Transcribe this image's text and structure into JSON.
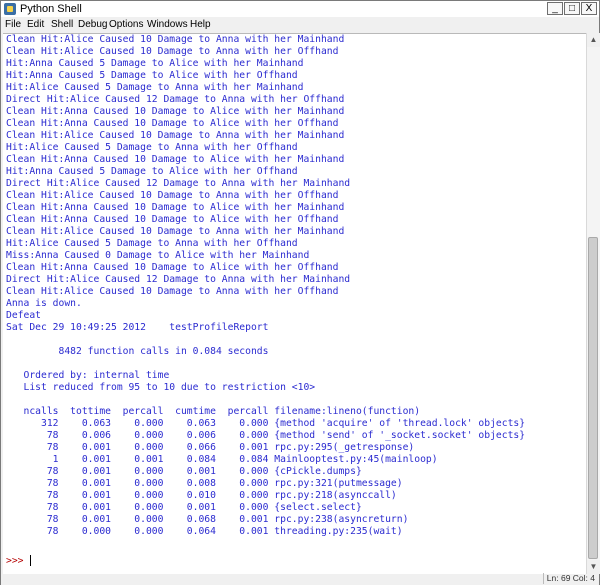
{
  "window": {
    "title": "Python Shell",
    "buttons": {
      "minimize": "_",
      "maximize": "□",
      "close": "X"
    }
  },
  "menu": [
    "File",
    "Edit",
    "Shell",
    "Debug",
    "Options",
    "Windows",
    "Help"
  ],
  "output_lines": [
    "Clean Hit:Alice Caused 10 Damage to Anna with her Mainhand",
    "Clean Hit:Alice Caused 10 Damage to Anna with her Offhand",
    "Hit:Anna Caused 5 Damage to Alice with her Mainhand",
    "Hit:Anna Caused 5 Damage to Alice with her Offhand",
    "Hit:Alice Caused 5 Damage to Anna with her Mainhand",
    "Direct Hit:Alice Caused 12 Damage to Anna with her Offhand",
    "Clean Hit:Anna Caused 10 Damage to Alice with her Mainhand",
    "Clean Hit:Anna Caused 10 Damage to Alice with her Offhand",
    "Clean Hit:Alice Caused 10 Damage to Anna with her Mainhand",
    "Hit:Alice Caused 5 Damage to Anna with her Offhand",
    "Clean Hit:Anna Caused 10 Damage to Alice with her Mainhand",
    "Hit:Anna Caused 5 Damage to Alice with her Offhand",
    "Direct Hit:Alice Caused 12 Damage to Anna with her Mainhand",
    "Clean Hit:Alice Caused 10 Damage to Anna with her Offhand",
    "Clean Hit:Anna Caused 10 Damage to Alice with her Mainhand",
    "Clean Hit:Anna Caused 10 Damage to Alice with her Offhand",
    "Clean Hit:Alice Caused 10 Damage to Anna with her Mainhand",
    "Hit:Alice Caused 5 Damage to Anna with her Offhand",
    "Miss:Anna Caused 0 Damage to Alice with her Mainhand",
    "Clean Hit:Anna Caused 10 Damage to Alice with her Offhand",
    "Direct Hit:Alice Caused 12 Damage to Anna with her Mainhand",
    "Clean Hit:Alice Caused 10 Damage to Anna with her Offhand",
    "Anna is down.",
    "Defeat",
    "Sat Dec 29 10:49:25 2012    testProfileReport",
    "",
    "         8482 function calls in 0.084 seconds",
    "",
    "   Ordered by: internal time",
    "   List reduced from 95 to 10 due to restriction <10>",
    "",
    "   ncalls  tottime  percall  cumtime  percall filename:lineno(function)",
    "      312    0.063    0.000    0.063    0.000 {method 'acquire' of 'thread.lock' objects}",
    "       78    0.006    0.000    0.006    0.000 {method 'send' of '_socket.socket' objects}",
    "       78    0.001    0.000    0.066    0.001 rpc.py:295(_getresponse)",
    "        1    0.001    0.001    0.084    0.084 Mainlooptest.py:45(mainloop)",
    "       78    0.001    0.000    0.001    0.000 {cPickle.dumps}",
    "       78    0.001    0.000    0.008    0.000 rpc.py:321(putmessage)",
    "       78    0.001    0.000    0.010    0.000 rpc.py:218(asynccall)",
    "       78    0.001    0.000    0.001    0.000 {select.select}",
    "       78    0.001    0.000    0.068    0.001 rpc.py:238(asyncreturn)",
    "       78    0.000    0.000    0.064    0.001 threading.py:235(wait)"
  ],
  "prompt": ">>>",
  "status": "Ln: 69 Col: 4",
  "colors": {
    "output": "#2b2bd0",
    "prompt": "#b40000",
    "background": "#ffffff"
  }
}
